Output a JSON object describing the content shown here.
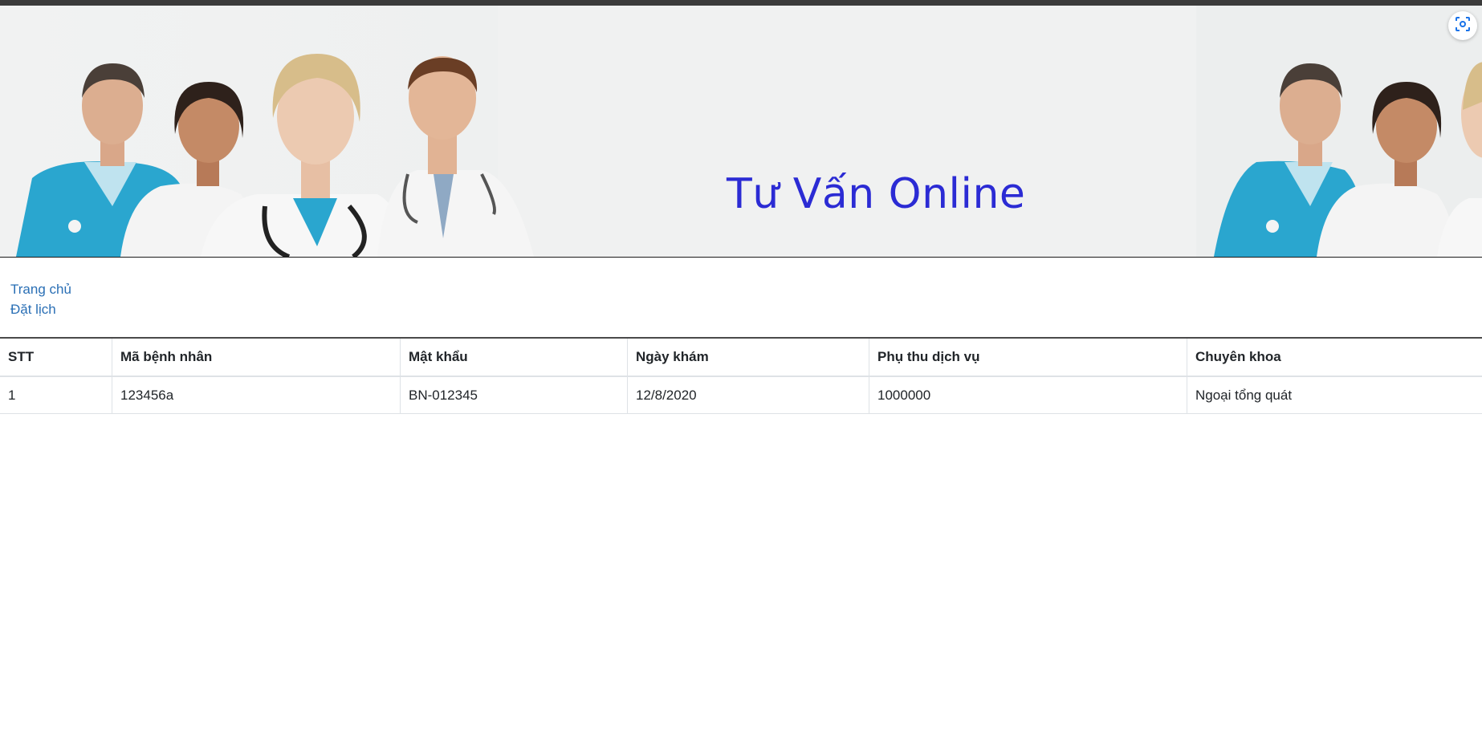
{
  "banner": {
    "title": "Tư Vấn Online",
    "title_color": "#2b2bd4"
  },
  "screenshot_button": {
    "icon": "screenshot-capture-icon"
  },
  "nav": {
    "items": [
      {
        "label": "Trang chủ"
      },
      {
        "label": "Đặt lịch"
      }
    ],
    "link_color": "#2a6fb5"
  },
  "table": {
    "columns": [
      "STT",
      "Mã bệnh nhân",
      "Mật khẩu",
      "Ngày khám",
      "Phụ thu dịch vụ",
      "Chuyên khoa"
    ],
    "rows": [
      [
        "1",
        "123456a",
        "BN-012345",
        "12/8/2020",
        "1000000",
        "Ngoại tổng quát"
      ]
    ]
  }
}
